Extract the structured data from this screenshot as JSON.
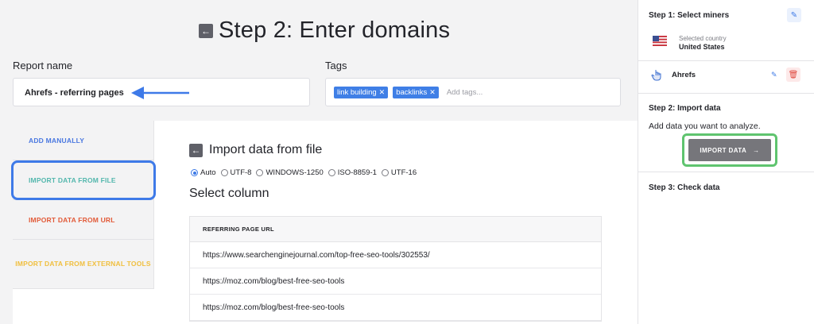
{
  "header": {
    "title": "Step 2: Enter domains",
    "back_icon": "arrow-left-icon"
  },
  "report": {
    "label": "Report name",
    "value": "Ahrefs - referring pages"
  },
  "tags": {
    "label": "Tags",
    "items": [
      "link building",
      "backlinks"
    ],
    "placeholder": "Add tags..."
  },
  "tabs": [
    {
      "label": "ADD MANUALLY",
      "color": "#4a78e0"
    },
    {
      "label": "IMPORT DATA FROM FILE",
      "color": "#53b7ad"
    },
    {
      "label": "IMPORT DATA FROM URL",
      "color": "#e25a38"
    },
    {
      "label": "IMPORT DATA FROM EXTERNAL TOOLS",
      "color": "#f0bf3e"
    }
  ],
  "panel": {
    "title": "Import data from file",
    "encodings": [
      {
        "label": "Auto",
        "selected": true
      },
      {
        "label": "UTF-8",
        "selected": false
      },
      {
        "label": "WINDOWS-1250",
        "selected": false
      },
      {
        "label": "ISO-8859-1",
        "selected": false
      },
      {
        "label": "UTF-16",
        "selected": false
      }
    ],
    "select_column": "Select column",
    "table": {
      "header": "REFERRING PAGE URL",
      "rows": [
        "https://www.searchenginejournal.com/top-free-seo-tools/302553/",
        "https://moz.com/blog/best-free-seo-tools",
        "https://moz.com/blog/best-free-seo-tools"
      ]
    }
  },
  "sidebar": {
    "step1": "Step 1: Select miners",
    "country_label": "Selected country",
    "country": "United States",
    "miner": "Ahrefs",
    "step2": "Step 2: Import data",
    "step2_desc": "Add data you want to analyze.",
    "import_button": "IMPORT DATA",
    "step3": "Step 3: Check data"
  },
  "colors": {
    "accent": "#3e7ae8",
    "highlight_green": "#5fc46f",
    "tag": "#3f7fe6"
  }
}
